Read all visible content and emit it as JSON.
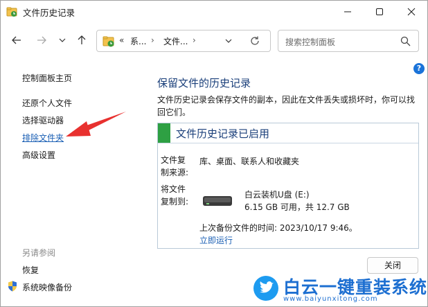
{
  "window": {
    "title": "文件历史记录",
    "icon": "file-history-icon"
  },
  "address_bar": {
    "overflow": "«",
    "crumbs": [
      "系...",
      "文件..."
    ],
    "separator": "›"
  },
  "search": {
    "placeholder": "搜索控制面板"
  },
  "help_label": "?",
  "sidebar": {
    "items": [
      {
        "label": "控制面板主页"
      },
      {
        "label": "还原个人文件"
      },
      {
        "label": "选择驱动器"
      },
      {
        "label": "排除文件夹",
        "active": true
      },
      {
        "label": "高级设置"
      }
    ],
    "see_also_title": "另请参阅",
    "see_also": [
      {
        "label": "恢复"
      },
      {
        "label": "系统映像备份",
        "icon": "uac-shield-icon"
      }
    ]
  },
  "main": {
    "title": "保留文件的历史记录",
    "description": "文件历史记录会保存文件的副本，因此在文件丢失或损坏时，你可以找回它们。",
    "status_title": "文件历史记录已启用",
    "status_color": "#2ea043",
    "copy_from_label_1": "文件复",
    "copy_from_label_2": "制来源:",
    "copy_from_value": "库、桌面、联系人和收藏夹",
    "copy_to_label_1": "将文件",
    "copy_to_label_2": "复制到:",
    "drive_name": "白云装机U盘 (E:)",
    "drive_space": "6.15 GB 可用，共 12.7 GB",
    "last_backup": "上次备份文件的时间: 2023/10/17 9:46。",
    "run_now": "立即运行",
    "close_button": "关闭"
  },
  "annotation": {
    "color": "#e8312f"
  },
  "watermark": {
    "brand": "白云一键重装系统",
    "url": "www.baiyunxitong.com",
    "color": "#1d6fd1"
  }
}
